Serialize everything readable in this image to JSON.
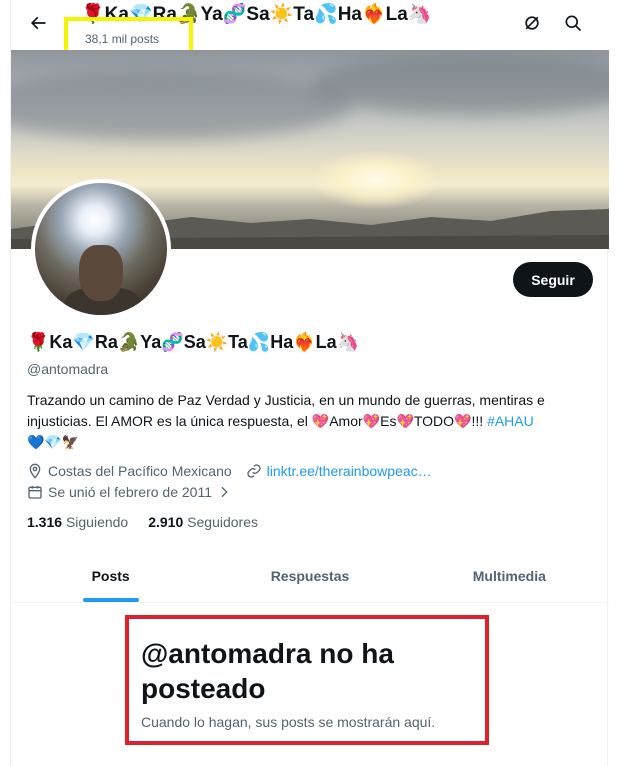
{
  "header": {
    "title": "🌹Ka💎Ra🐊Ya🧬Sa☀️Ta💦Ha❤️‍🔥La🦄",
    "post_count": "38,1 mil posts",
    "back_icon": "arrow-left-icon",
    "grok_icon": "slashed-circle-icon",
    "search_icon": "search-icon"
  },
  "profile": {
    "display_name": "🌹Ka💎Ra🐊Ya🧬Sa☀️Ta💦Ha❤️‍🔥La🦄",
    "handle": "@antomadra",
    "follow_label": "Seguir",
    "bio_text": "Trazando un camino de Paz Verdad y Justicia, en un mundo de guerras, mentiras e injusticias. El AMOR es la única respuesta, el 💖Amor💖Es💖TODO💖!!! ",
    "bio_hashtag": "#AHAU",
    "bio_tail": "💙💎🦅",
    "location": "Costas del Pacífico Mexicano",
    "website": "linktr.ee/therainbowpeac…",
    "joined": "Se unió el febrero de 2011",
    "following_count": "1.316",
    "following_label": "Siguiendo",
    "followers_count": "2.910",
    "followers_label": "Seguidores"
  },
  "tabs": [
    {
      "label": "Posts",
      "active": true
    },
    {
      "label": "Respuestas",
      "active": false
    },
    {
      "label": "Multimedia",
      "active": false
    }
  ],
  "empty_state": {
    "title": "@antomadra no ha posteado",
    "subtitle": "Cuando lo hagan, sus posts se mostrarán aquí."
  },
  "colors": {
    "accent": "#1d9bf0",
    "text": "#0f1419",
    "muted": "#536471",
    "highlight_yellow": "#f5f500",
    "highlight_red": "#e0202a"
  }
}
